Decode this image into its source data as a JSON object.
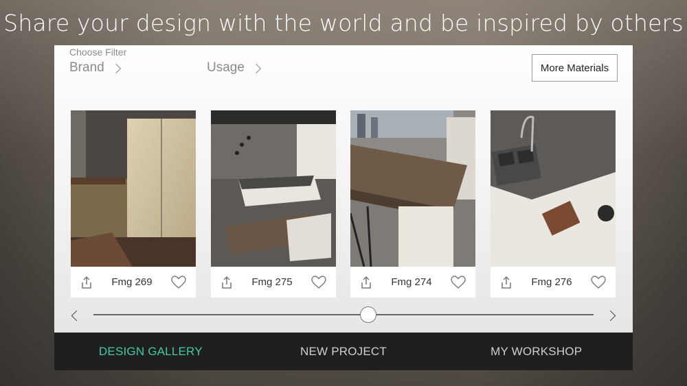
{
  "headline": "Share your design with the world and be inspired by others",
  "filters": {
    "caption": "Choose Filter",
    "items": [
      {
        "label": "Brand"
      },
      {
        "label": "Usage"
      }
    ]
  },
  "more_materials_label": "More Materials",
  "gallery": {
    "cards": [
      {
        "title": "Fmg 269"
      },
      {
        "title": "Fmg 275"
      },
      {
        "title": "Fmg 274"
      },
      {
        "title": "Fmg 276"
      }
    ],
    "slider_position": 0.55
  },
  "nav": {
    "items": [
      {
        "label": "DESIGN GALLERY",
        "active": true
      },
      {
        "label": "NEW PROJECT",
        "active": false
      },
      {
        "label": "MY WORKSHOP",
        "active": false
      }
    ],
    "accent_color": "#44c9a8"
  },
  "icons": {
    "share": "share-icon",
    "like": "heart-icon",
    "prev": "chevron-left-icon",
    "next": "chevron-right-icon"
  }
}
